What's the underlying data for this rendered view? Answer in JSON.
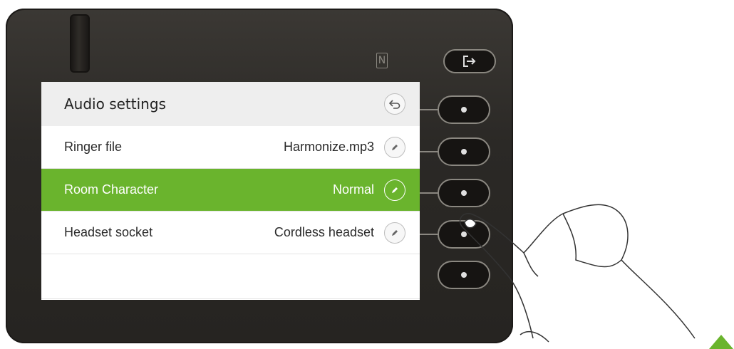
{
  "screen": {
    "title": "Audio settings",
    "back_icon": "back-arrow-icon",
    "rows": [
      {
        "label": "Ringer file",
        "value": "Harmonize.mp3",
        "icon": "pencil-icon",
        "selected": false
      },
      {
        "label": "Room Character",
        "value": "Normal",
        "icon": "pencil-icon",
        "selected": true
      },
      {
        "label": "Headset socket",
        "value": "Cordless headset",
        "icon": "pencil-icon",
        "selected": false
      }
    ]
  },
  "device": {
    "nfc_mark": "N",
    "exit_icon": "exit-icon"
  },
  "colors": {
    "highlight": "#6ab42d",
    "housing": "#2b2926",
    "triangle": "#6ab42d"
  }
}
